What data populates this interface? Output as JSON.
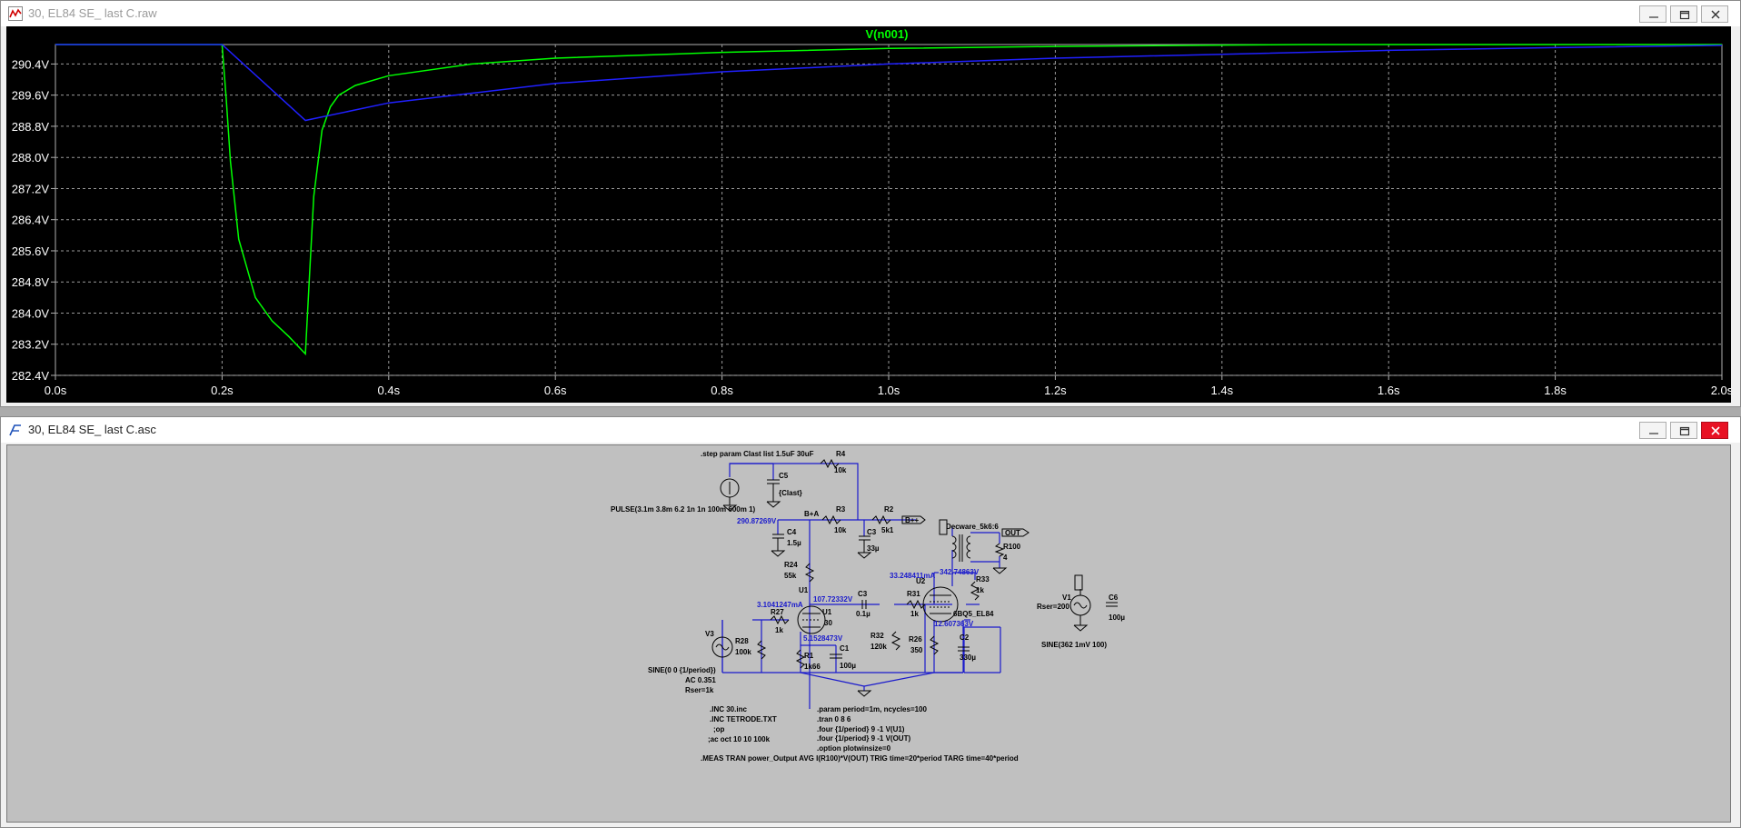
{
  "waveform_window": {
    "title": "30, EL84 SE_ last C.raw",
    "trace_label": "V(n001)",
    "colors": {
      "trace_green": "#00ff00",
      "trace_blue": "#2020ff",
      "grid": "#9a9a9a",
      "axis_text": "#ffffff"
    }
  },
  "schematic_window": {
    "title": "30, EL84 SE_ last C.asc",
    "step_directive": ".step param Clast list  1.5uF 30uF",
    "pulse_source": "PULSE(3.1m 3.8m 6.2 1n 1n 100m 600m 1)",
    "nodes": {
      "b_plus_voltage": "290.87269V",
      "b_plus_a": "B+A",
      "b_plus_plus": "B++",
      "u1_current": "3.1041247mA",
      "u1_plate": "107.72332V",
      "u1_cathode": "5.1528473V",
      "u2_current": "33.248411mA",
      "u2_plate": "342.74863V",
      "u2_cathode": "12.607363V",
      "out": "OUT"
    },
    "components": {
      "c5": "C5",
      "c5_val": "{Clast}",
      "r4": "R4",
      "r4_val": "10k",
      "c4": "C4",
      "c4_val": "1.5µ",
      "r3": "R3",
      "r3_val": "10k",
      "r2": "R2",
      "r2_val": "5k1",
      "c3a": "C3",
      "c3a_val": "33µ",
      "r24": "R24",
      "r24_val": "55k",
      "u1_side": "U1",
      "c3": "C3",
      "c3_val": "0.1µ",
      "r27": "R27",
      "r27_val": "1k",
      "u1": "U1",
      "u1_val": "30",
      "r28": "R28",
      "r28_val": "100k",
      "r1": "R1",
      "r1_val": "1k66",
      "c1": "C1",
      "c1_val": "100µ",
      "v3": "V3",
      "v3_sine": "SINE(0 0 {1/period})",
      "v3_ac": "AC 0.351",
      "v3_rser": "Rser=1k",
      "r31": "R31",
      "r31_val": "1k",
      "u2": "U2",
      "u2_val": "6BQ5_EL84",
      "r32": "R32",
      "r32_val": "120k",
      "r26": "R26",
      "r26_val": "350",
      "c2": "C2",
      "c2_val": "330µ",
      "r33": "R33",
      "r33_val": "1k",
      "xfmr": "Decware_5k6:6",
      "r100": "R100",
      "r100_val": "4",
      "v1": "V1",
      "v1_rser": "Rser=200",
      "c6": "C6",
      "c6_val": "100µ",
      "v1_sine": "SINE(362 1mV 100)"
    },
    "directives_left": [
      ".INC 30.inc",
      ".INC TETRODE.TXT",
      ";op",
      ";ac oct 10 10 100k"
    ],
    "directives_right": [
      ".param period=1m, ncycles=100",
      ".tran 0 8 6",
      ".four {1/period} 9 -1 V(U1)",
      ".four {1/period} 9 -1 V(OUT)",
      ".option plotwinsize=0"
    ],
    "meas_directive": ".MEAS TRAN power_Output AVG I(R100)*V(OUT) TRIG time=20*period TARG time=40*period"
  },
  "chart_data": {
    "type": "line",
    "title": "V(n001)",
    "xlabel": "",
    "ylabel": "",
    "x_ticks": [
      "0.0s",
      "0.2s",
      "0.4s",
      "0.6s",
      "0.8s",
      "1.0s",
      "1.2s",
      "1.4s",
      "1.6s",
      "1.8s",
      "2.0s"
    ],
    "y_ticks": [
      "290.4V",
      "289.6V",
      "288.8V",
      "288.0V",
      "287.2V",
      "286.4V",
      "285.6V",
      "284.8V",
      "284.0V",
      "283.2V",
      "282.4V"
    ],
    "xlim": [
      0,
      2.0
    ],
    "ylim": [
      282.4,
      290.9
    ],
    "grid": true,
    "legend": "top-center",
    "series": [
      {
        "color": "#00ff00",
        "x": [
          0,
          0.2,
          0.205,
          0.21,
          0.22,
          0.24,
          0.26,
          0.28,
          0.3,
          0.305,
          0.31,
          0.32,
          0.33,
          0.34,
          0.36,
          0.4,
          0.5,
          0.6,
          0.8,
          1.0,
          1.2,
          1.5,
          2.0
        ],
        "y": [
          290.9,
          290.9,
          289.5,
          287.9,
          285.9,
          284.4,
          283.8,
          283.4,
          282.95,
          285.0,
          287.0,
          288.7,
          289.3,
          289.6,
          289.85,
          290.1,
          290.4,
          290.55,
          290.7,
          290.8,
          290.85,
          290.9,
          290.9
        ]
      },
      {
        "color": "#2020ff",
        "x": [
          0,
          0.2,
          0.3,
          0.4,
          0.6,
          0.8,
          1.0,
          1.2,
          1.4,
          1.6,
          1.8,
          2.0
        ],
        "y": [
          290.9,
          290.9,
          288.95,
          289.4,
          289.9,
          290.2,
          290.4,
          290.55,
          290.65,
          290.75,
          290.82,
          290.88
        ]
      }
    ]
  }
}
